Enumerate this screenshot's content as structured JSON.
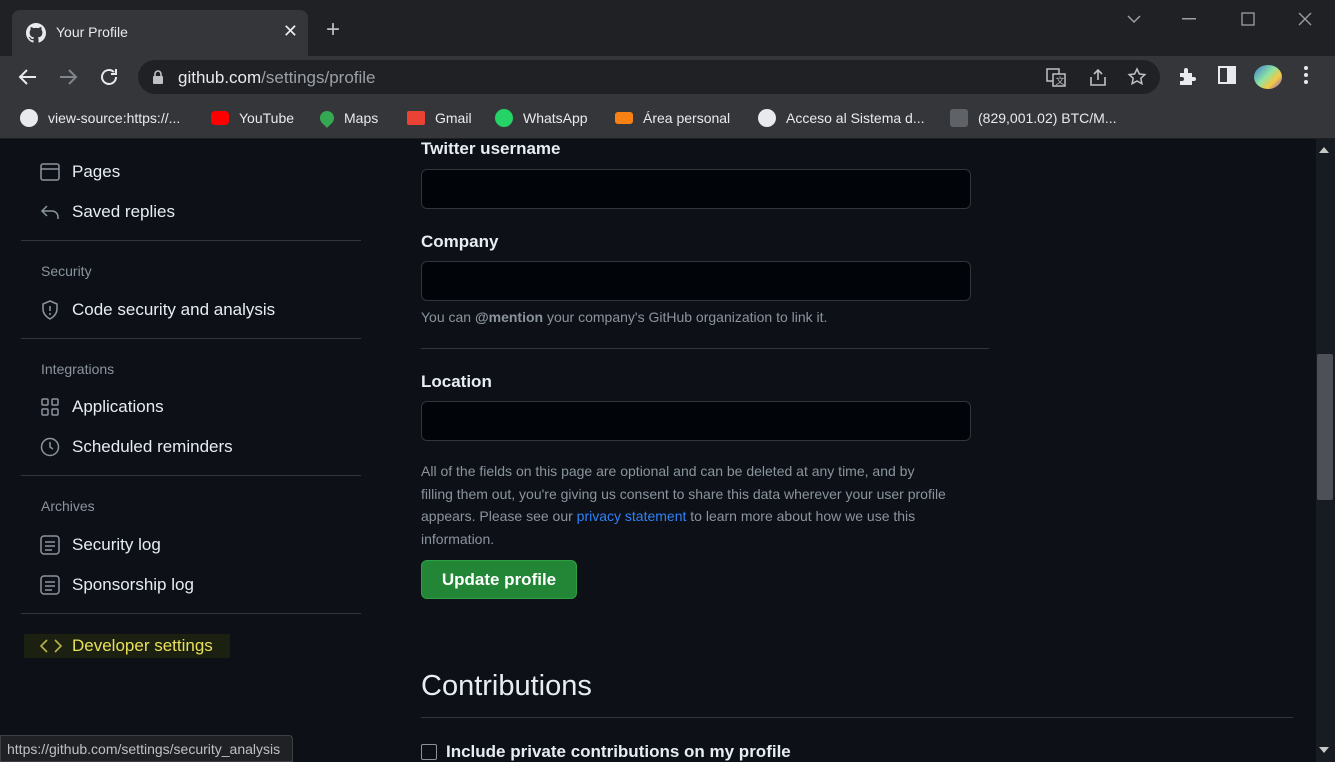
{
  "browser": {
    "tab_title": "Your Profile",
    "tab_close": "✕",
    "new_tab": "+",
    "url_host": "github.com",
    "url_path": "/settings/profile",
    "status_url": "https://github.com/settings/security_analysis",
    "bookmarks": [
      {
        "label": "view-source:https://...",
        "icon": "globe-icon",
        "color": "#e8eaed"
      },
      {
        "label": "YouTube",
        "icon": "youtube-icon",
        "color": "#ff0000"
      },
      {
        "label": "Maps",
        "icon": "maps-icon",
        "color": "#34a853"
      },
      {
        "label": "Gmail",
        "icon": "gmail-icon",
        "color": "#ea4335"
      },
      {
        "label": "WhatsApp",
        "icon": "whatsapp-icon",
        "color": "#25d366"
      },
      {
        "label": "Área personal",
        "icon": "moodle-icon",
        "color": "#f98012"
      },
      {
        "label": "Acceso al Sistema d...",
        "icon": "globe-icon",
        "color": "#e8eaed"
      },
      {
        "label": "(829,001.02) BTC/M...",
        "icon": "ticker-icon",
        "color": "#5f6368"
      }
    ]
  },
  "sidebar": {
    "items_top": [
      {
        "label": "Pages",
        "icon": "browser-icon"
      },
      {
        "label": "Saved replies",
        "icon": "reply-icon"
      }
    ],
    "security_heading": "Security",
    "security_items": [
      {
        "label": "Code security and analysis",
        "icon": "shield-icon"
      }
    ],
    "integrations_heading": "Integrations",
    "integrations_items": [
      {
        "label": "Applications",
        "icon": "apps-icon"
      },
      {
        "label": "Scheduled reminders",
        "icon": "clock-icon"
      }
    ],
    "archives_heading": "Archives",
    "archives_items": [
      {
        "label": "Security log",
        "icon": "log-icon"
      },
      {
        "label": "Sponsorship log",
        "icon": "log-icon"
      }
    ],
    "developer_settings": "Developer settings"
  },
  "form": {
    "twitter_label": "Twitter username",
    "twitter_value": "",
    "company_label": "Company",
    "company_value": "",
    "company_note_prefix": "You can ",
    "company_note_mention": "@mention",
    "company_note_suffix": " your company's GitHub organization to link it.",
    "location_label": "Location",
    "location_value": "",
    "optional_text_1": "All of the fields on this page are optional and can be deleted at any time, and by",
    "optional_text_2": "filling them out, you're giving us consent to share this data wherever your user profile",
    "optional_text_3_prefix": "appears. Please see our ",
    "privacy_link": "privacy statement",
    "optional_text_3_suffix": " to learn more about how we use this",
    "optional_text_4": "information.",
    "update_button": "Update profile"
  },
  "contributions": {
    "heading": "Contributions",
    "private_checkbox_label": "Include private contributions on my profile",
    "private_checked": false
  }
}
